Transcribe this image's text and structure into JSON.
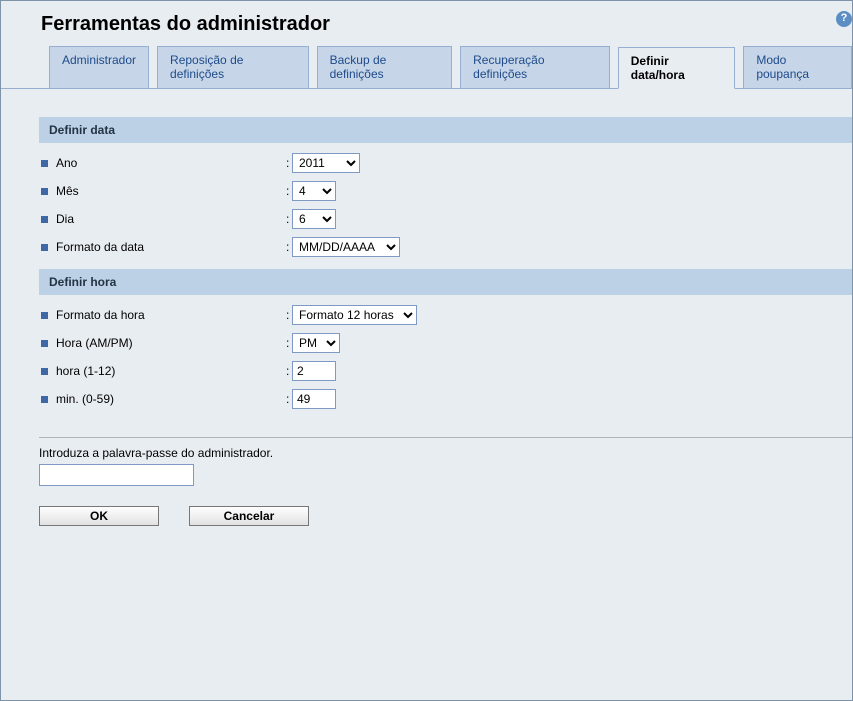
{
  "page_title": "Ferramentas do administrador",
  "help_icon_label": "?",
  "tabs": [
    {
      "label": "Administrador",
      "active": false
    },
    {
      "label": "Reposição de definições",
      "active": false
    },
    {
      "label": "Backup de definições",
      "active": false
    },
    {
      "label": "Recuperação definições",
      "active": false
    },
    {
      "label": "Definir data/hora",
      "active": true
    },
    {
      "label": "Modo poupança",
      "active": false
    }
  ],
  "date_section": {
    "header": "Definir data",
    "fields": {
      "year": {
        "label": "Ano",
        "value": "2011"
      },
      "month": {
        "label": "Mês",
        "value": "4"
      },
      "day": {
        "label": "Dia",
        "value": "6"
      },
      "format": {
        "label": "Formato da data",
        "value": "MM/DD/AAAA"
      }
    }
  },
  "time_section": {
    "header": "Definir hora",
    "fields": {
      "format": {
        "label": "Formato da hora",
        "value": "Formato 12 horas"
      },
      "ampm": {
        "label": "Hora (AM/PM)",
        "value": "PM"
      },
      "hour": {
        "label": "hora (1-12)",
        "value": "2"
      },
      "minute": {
        "label": "min. (0-59)",
        "value": "49"
      }
    }
  },
  "password": {
    "label": "Introduza a palavra-passe do administrador.",
    "value": ""
  },
  "buttons": {
    "ok": "OK",
    "cancel": "Cancelar"
  },
  "colon": ":"
}
